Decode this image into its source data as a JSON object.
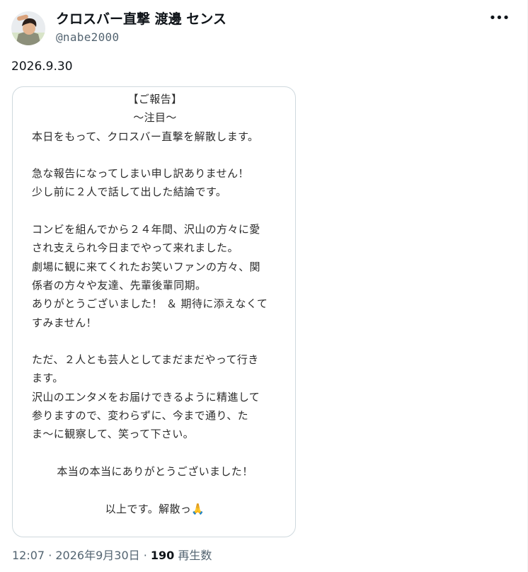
{
  "author": {
    "display_name": "クロスバー直撃 渡邊 センス",
    "handle": "@nabe2000"
  },
  "menu": {
    "more_glyph": "•••"
  },
  "tweet": {
    "text": "2026.9.30",
    "image_lines": [
      {
        "text": "【ご報告】",
        "align": "center"
      },
      {
        "text": "〜注目〜",
        "align": "center"
      },
      {
        "text": "本日をもって、クロスバー直撃を解散します。",
        "align": "left"
      },
      {
        "text": "",
        "align": "left"
      },
      {
        "text": "急な報告になってしまい申し訳ありません！",
        "align": "left"
      },
      {
        "text": "少し前に２人で話して出した結論です。",
        "align": "left"
      },
      {
        "text": "",
        "align": "left"
      },
      {
        "text": "コンビを組んでから２４年間、沢山の方々に愛",
        "align": "left"
      },
      {
        "text": "され支えられ今日までやって来れました。",
        "align": "left"
      },
      {
        "text": "劇場に観に来てくれたお笑いファンの方々、関",
        "align": "left"
      },
      {
        "text": "係者の方々や友達、先輩後輩同期。",
        "align": "left"
      },
      {
        "text": "ありがとうございました！ ＆ 期待に添えなくて",
        "align": "left"
      },
      {
        "text": "すみません！",
        "align": "left"
      },
      {
        "text": "",
        "align": "left"
      },
      {
        "text": "ただ、２人とも芸人としてまだまだやって行き",
        "align": "left"
      },
      {
        "text": "ます。",
        "align": "left"
      },
      {
        "text": "沢山のエンタメをお届けできるように精進して",
        "align": "left"
      },
      {
        "text": "参りますので、変わらずに、今まで通り、た",
        "align": "left"
      },
      {
        "text": "ま〜に観察して、笑って下さい。",
        "align": "left"
      },
      {
        "text": "",
        "align": "left"
      },
      {
        "text": "本当の本当にありがとうございました！",
        "align": "center"
      },
      {
        "text": "",
        "align": "left"
      },
      {
        "text": "以上です。解散っ🙏",
        "align": "center"
      }
    ]
  },
  "meta": {
    "time": "12:07",
    "separator": " · ",
    "date": "2026年9月30日",
    "views_count": "190",
    "views_label": "再生数"
  },
  "colors": {
    "text_primary": "#0f1419",
    "text_secondary": "#536471",
    "border": "#cfd9de",
    "notice_text": "#2b2b2b"
  }
}
